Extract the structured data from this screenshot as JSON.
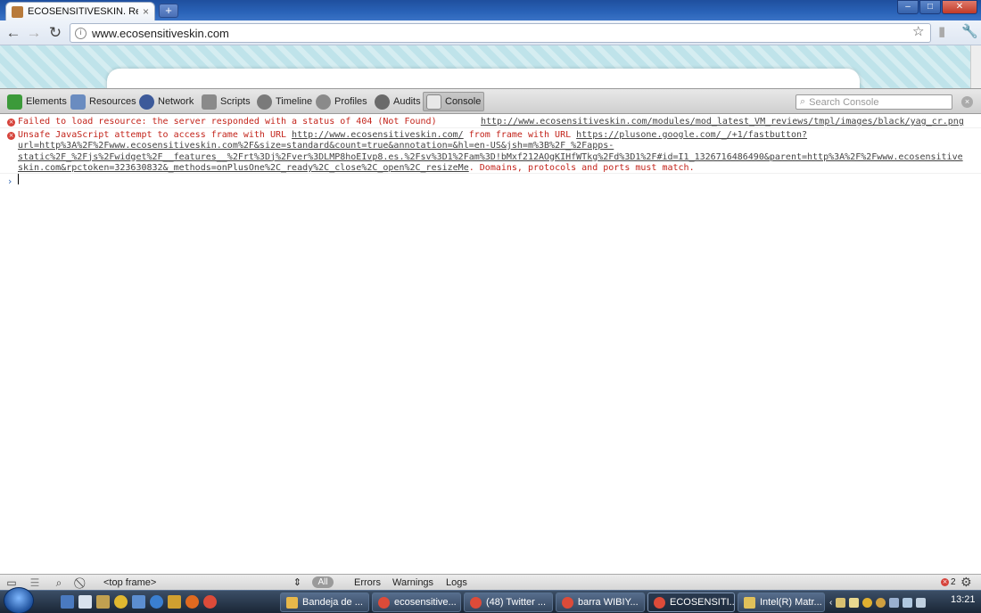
{
  "browser": {
    "tab_title": "ECOSENSITIVESKIN. Regalo",
    "tab_close": "×",
    "new_tab": "+",
    "url": "www.ecosensitiveskin.com",
    "window_controls": {
      "minimize": "–",
      "maximize": "□",
      "close": "✕"
    }
  },
  "devtools": {
    "tabs": [
      {
        "label": "Elements",
        "icon": "elements-icon",
        "color": "#3c9a3a"
      },
      {
        "label": "Resources",
        "icon": "resources-icon",
        "color": "#6a8cc0"
      },
      {
        "label": "Network",
        "icon": "network-icon",
        "color": "#3d5a9a"
      },
      {
        "label": "Scripts",
        "icon": "scripts-icon",
        "color": "#8a8a8a"
      },
      {
        "label": "Timeline",
        "icon": "timeline-icon",
        "color": "#7a7a7a"
      },
      {
        "label": "Profiles",
        "icon": "profiles-icon",
        "color": "#8a8a8a"
      },
      {
        "label": "Audits",
        "icon": "audits-icon",
        "color": "#6a6a6a"
      },
      {
        "label": "Console",
        "icon": "console-icon",
        "color": "#a0a0a0"
      }
    ],
    "active_tab": "Console",
    "search_placeholder": "Search Console"
  },
  "console": {
    "messages": [
      {
        "lines": [
          "Failed to load resource: the server responded with a status of 404 (Not Found)"
        ],
        "source": "http://www.ecosensitiveskin.com/modules/mod_latest_VM_reviews/tmpl/images/black/yag_cr.png"
      },
      {
        "line1_text": "Unsafe JavaScript attempt to access frame with URL ",
        "line1_link1": "http://www.ecosensitiveskin.com/",
        "line1_mid": " from frame with URL ",
        "line1_link2": "https://plusone.google.com/_/+1/fastbutton?",
        "line2": "url=http%3A%2F%2Fwww.ecosensitiveskin.com%2F&size=standard&count=true&annotation=&hl=en-US&jsh=m%3B%2F_%2Fapps-",
        "line3": "static%2F_%2Fjs%2Fwidget%2F__features__%2Frt%3Dj%2Fver%3DLMP8hoEIvp8.es.%2Fsv%3D1%2Fam%3D!bMxf212AOgKIHfWTkg%2Fd%3D1%2F#id=I1_1326716486490&parent=http%3A%2F%2Fwww.ecosensitive",
        "line4_link": "skin.com&rpctoken=323630832&_methods=onPlusOne%2C_ready%2C_close%2C_open%2C_resizeMe",
        "line4_tail": ". Domains, protocols and ports must match."
      }
    ],
    "prompt": "›"
  },
  "status_bar": {
    "frame": "<top frame>",
    "frame_arrow": "⇕",
    "filters": [
      "All",
      "Errors",
      "Warnings",
      "Logs"
    ],
    "error_count": "2"
  },
  "taskbar": {
    "tasks": [
      {
        "label": "Bandeja de ...",
        "icon": "mail-icon",
        "color": "#e8b84a"
      },
      {
        "label": "ecosensitive...",
        "icon": "chrome-icon",
        "color": "#dd4b39"
      },
      {
        "label": "(48) Twitter ...",
        "icon": "chrome-icon",
        "color": "#dd4b39"
      },
      {
        "label": "barra WIBIY...",
        "icon": "chrome-icon",
        "color": "#dd4b39"
      },
      {
        "label": "ECOSENSITI...",
        "icon": "chrome-icon",
        "color": "#dd4b39"
      },
      {
        "label": "Intel(R) Matr...",
        "icon": "intel-icon",
        "color": "#e0c05a"
      }
    ],
    "active_task": 4,
    "clock": "13:21"
  }
}
